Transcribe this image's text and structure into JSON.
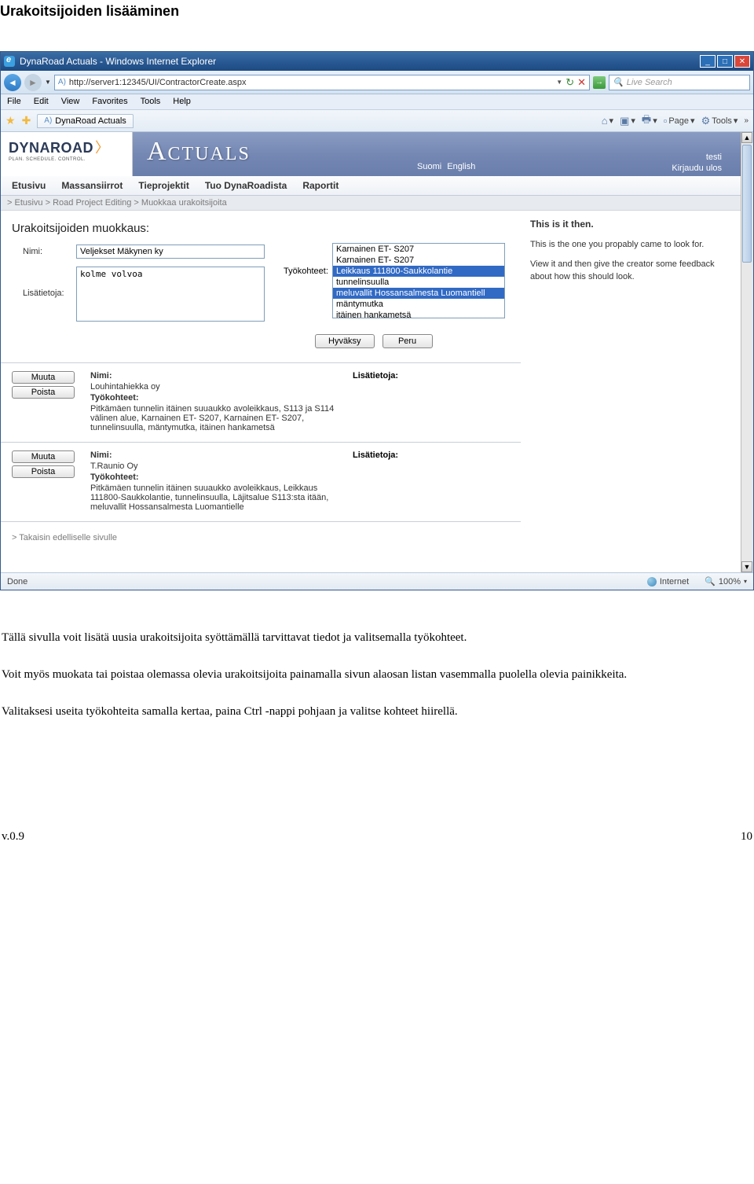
{
  "doc": {
    "title": "Urakoitsijoiden lisääminen",
    "para1": "Tällä sivulla voit lisätä uusia urakoitsijoita syöttämällä tarvittavat tiedot ja valitsemalla työkohteet.",
    "para2": "Voit myös muokata tai poistaa olemassa olevia urakoitsijoita painamalla sivun alaosan listan vasemmalla puolella olevia painikkeita.",
    "para3": "Valitaksesi useita työkohteita samalla kertaa, paina Ctrl -nappi pohjaan ja valitse kohteet hiirellä.",
    "footer_left": "v.0.9",
    "footer_right": "10"
  },
  "browser": {
    "title": "DynaRoad Actuals - Windows Internet Explorer",
    "url": "http://server1:12345/UI/ContractorCreate.aspx",
    "search_placeholder": "Live Search",
    "menu": [
      "File",
      "Edit",
      "View",
      "Favorites",
      "Tools",
      "Help"
    ],
    "tab_title": "DynaRoad Actuals",
    "toolbar": {
      "page": "Page",
      "tools": "Tools"
    },
    "status_done": "Done",
    "status_net": "Internet",
    "zoom": "100%"
  },
  "app": {
    "logo_main": "DYNAROAD",
    "logo_sub": "PLAN. SCHEDULE. CONTROL.",
    "actuals_title": "Actuals",
    "lang1": "Suomi",
    "lang2": "English",
    "user": "testi",
    "logout": "Kirjaudu ulos",
    "tabs": [
      "Etusivu",
      "Massansiirrot",
      "Tieprojektit",
      "Tuo DynaRoadista",
      "Raportit"
    ],
    "breadcrumb": "> Etusivu  > Road Project Editing  > Muokkaa urakoitsijoita",
    "section_title": "Urakoitsijoiden muokkaus:",
    "labels": {
      "nimi": "Nimi:",
      "lisatietoja": "Lisätietoja:",
      "tyokohteet": "Työkohteet:"
    },
    "form": {
      "nimi_value": "Veljekset Mäkynen ky",
      "lisa_value": "kolme volvoa",
      "options": [
        {
          "t": "Karnainen ET- S207",
          "sel": false
        },
        {
          "t": "Karnainen ET- S207",
          "sel": false
        },
        {
          "t": "Leikkaus 111800-Saukkolantie",
          "sel": true
        },
        {
          "t": "tunnelinsuulla",
          "sel": false
        },
        {
          "t": "meluvallit Hossansalmesta Luomantiell",
          "sel": true
        },
        {
          "t": "mäntymutka",
          "sel": false
        },
        {
          "t": "itäinen hankametsä",
          "sel": false
        }
      ]
    },
    "buttons": {
      "accept": "Hyväksy",
      "cancel": "Peru",
      "change": "Muuta",
      "remove": "Poista"
    },
    "side": {
      "title": "This is it then.",
      "p1": "This is the one you propably came to look for.",
      "p2": "View it and then give the creator some feedback about how this should look."
    },
    "contractors": [
      {
        "nimi": "Louhintahiekka oy",
        "lisa": "",
        "tyokohteet": "Pitkämäen tunnelin itäinen suuaukko avoleikkaus, S113 ja S114 välinen alue, Karnainen ET- S207, Karnainen ET- S207, tunnelinsuulla, mäntymutka, itäinen hankametsä"
      },
      {
        "nimi": "T.Raunio Oy",
        "lisa": "",
        "tyokohteet": "Pitkämäen tunnelin itäinen suuaukko avoleikkaus, Leikkaus 111800-Saukkolantie, tunnelinsuulla, Läjitsalue S113:sta itään, meluvallit Hossansalmesta Luomantielle"
      }
    ],
    "backlink": ">  Takaisin edelliselle sivulle"
  }
}
